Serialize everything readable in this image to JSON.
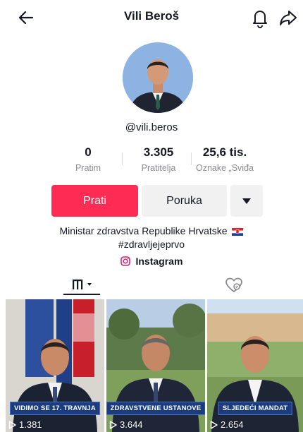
{
  "header": {
    "title": "Vili Beroš"
  },
  "profile": {
    "username": "@vili.beros"
  },
  "stats": [
    {
      "value": "0",
      "label": "Pratim"
    },
    {
      "value": "3.305",
      "label": "Pratitelja"
    },
    {
      "value": "25,6 tis.",
      "label": "Oznake „Sviđa"
    }
  ],
  "actions": {
    "follow": "Prati",
    "message": "Poruka"
  },
  "bio": {
    "line1": "Ministar zdravstva Republike Hrvatske",
    "line2": "#zdravljejeprvo"
  },
  "links": {
    "instagram": "Instagram"
  },
  "videos": [
    {
      "caption": "VIDIMO SE 17. TRAVNJA",
      "views": "1.381"
    },
    {
      "caption": "ZDRAVSTVENE USTANOVE",
      "views": "3.644"
    },
    {
      "caption": "SLJEDEĆI MANDAT",
      "views": "2.654"
    }
  ],
  "colors": {
    "accent": "#fe2c55",
    "text": "#161823",
    "secondary_text": "#8a8b91",
    "button_bg": "#f1f1f2",
    "caption_bg": "#1b3d80"
  },
  "icons": [
    "back-arrow-icon",
    "bell-icon",
    "share-icon",
    "dropdown-icon",
    "instagram-icon",
    "videos-grid-icon",
    "liked-hidden-icon",
    "play-icon",
    "croatia-flag-icon"
  ]
}
